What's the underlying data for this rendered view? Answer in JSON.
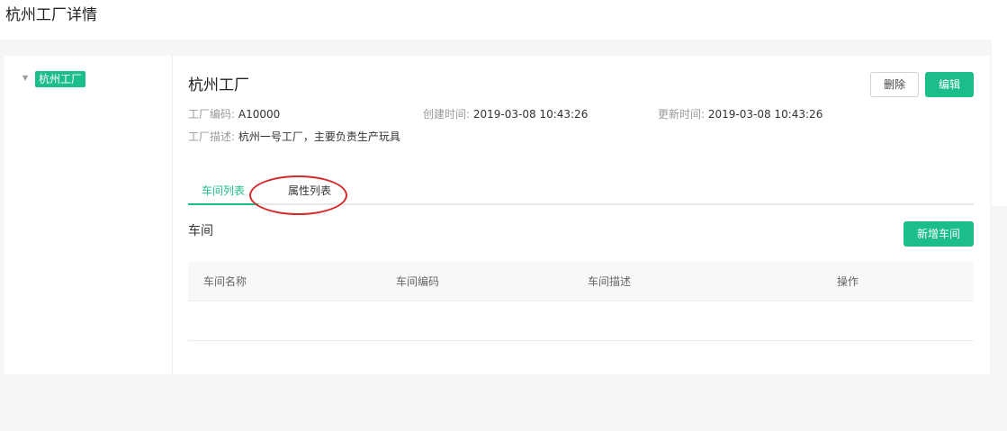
{
  "page": {
    "title": "杭州工厂详情"
  },
  "tree": {
    "root": {
      "label": "杭州工厂",
      "expanded": true
    }
  },
  "factory": {
    "name": "杭州工厂",
    "code_label": "工厂编码:",
    "code": "A10000",
    "created_label": "创建时间:",
    "created": "2019-03-08 10:43:26",
    "updated_label": "更新时间:",
    "updated": "2019-03-08 10:43:26",
    "desc_label": "工厂描述:",
    "desc": "杭州一号工厂，主要负责生产玩具"
  },
  "actions": {
    "delete_label": "删除",
    "edit_label": "编辑"
  },
  "tabs": [
    {
      "label": "车间列表",
      "active": true
    },
    {
      "label": "属性列表",
      "active": false
    }
  ],
  "workshop_section": {
    "title": "车间",
    "add_label": "新增车间",
    "columns": [
      "车间名称",
      "车间编码",
      "车间描述",
      "操作"
    ],
    "rows": []
  },
  "colors": {
    "accent": "#1bbd8a",
    "annotation": "#d62828"
  }
}
